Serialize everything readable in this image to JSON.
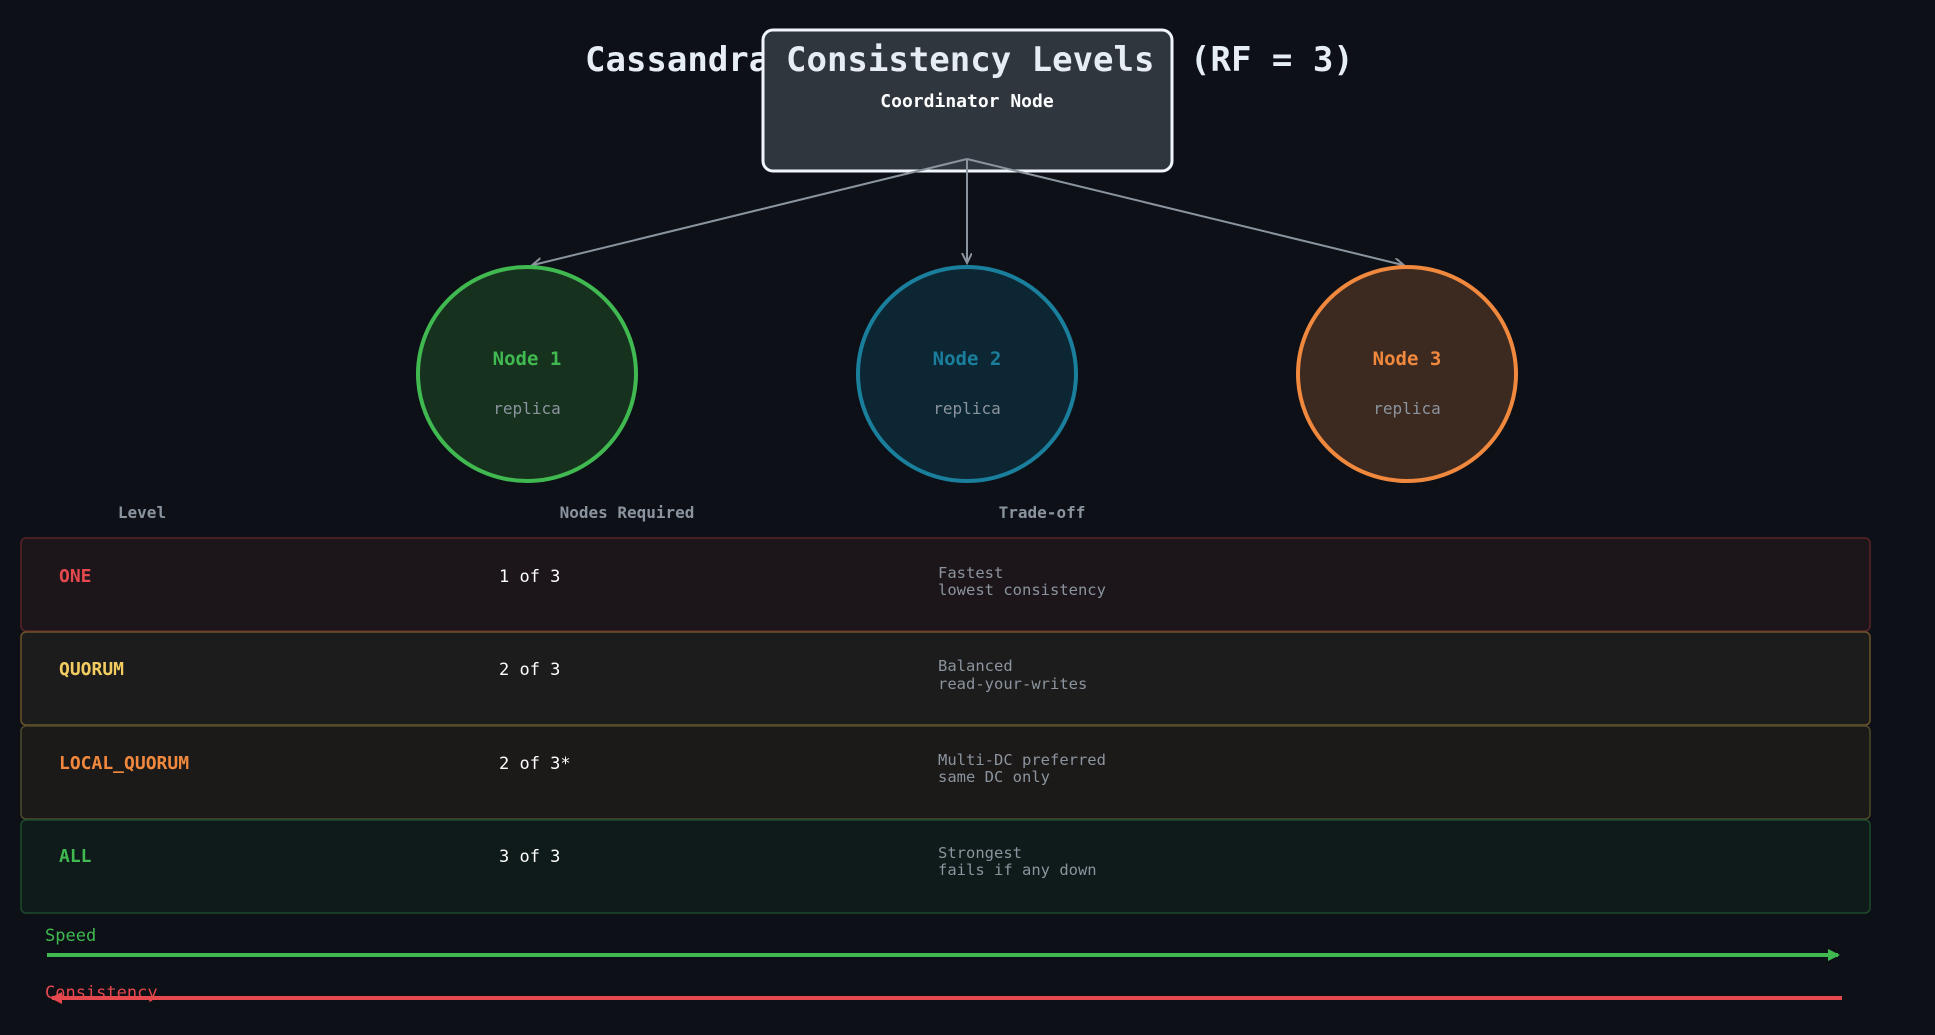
{
  "title_left": "Cassandra",
  "title_right": "Consistency Levels",
  "title_suffix": "(RF = 3)",
  "coordinator": {
    "label": "Coordinator Node"
  },
  "nodes": [
    {
      "name": "Node 1",
      "role": "replica",
      "color": "#3fb950",
      "fill": "#17311f"
    },
    {
      "name": "Node 2",
      "role": "replica",
      "color": "#1a7f9c",
      "fill": "#0d2633"
    },
    {
      "name": "Node 3",
      "role": "replica",
      "color": "#f0883e",
      "fill": "#3c2a20"
    }
  ],
  "table": {
    "headers": {
      "level": "Level",
      "nodes_required": "Nodes Required",
      "tradeoff": "Trade-off"
    },
    "rows": [
      {
        "level": "ONE",
        "nodes": "1 of 3",
        "tradeoff_line1": "Fastest",
        "tradeoff_line2": "lowest consistency",
        "color": "#e5484d",
        "bg": "#1c161b",
        "border": "#5a2328"
      },
      {
        "level": "QUORUM",
        "nodes": "2 of 3",
        "tradeoff_line1": "Balanced",
        "tradeoff_line2": "read-your-writes",
        "color": "#f2cc60",
        "bg": "#1c1c1c",
        "border": "#6b5428"
      },
      {
        "level": "LOCAL_QUORUM",
        "nodes": "2 of 3*",
        "tradeoff_line1": "Multi-DC preferred",
        "tradeoff_line2": "same DC only",
        "color": "#f0883e",
        "bg": "#1c1919",
        "border": "#4d4a2a"
      },
      {
        "level": "ALL",
        "nodes": "3 of 3",
        "tradeoff_line1": "Strongest",
        "tradeoff_line2": "fails if any down",
        "color": "#3fb950",
        "bg": "#0f1a1a",
        "border": "#1d4a2c"
      }
    ]
  },
  "scales": {
    "speed": {
      "label": "Speed",
      "color": "#3fb950",
      "direction": "right"
    },
    "consistency": {
      "label": "Consistency",
      "color": "#e5484d",
      "direction": "left"
    }
  },
  "colors": {
    "background": "#0d1117",
    "coordinator_fill": "#30363d",
    "coordinator_stroke": "#f0f6fc",
    "arrow": "#8b949e"
  }
}
